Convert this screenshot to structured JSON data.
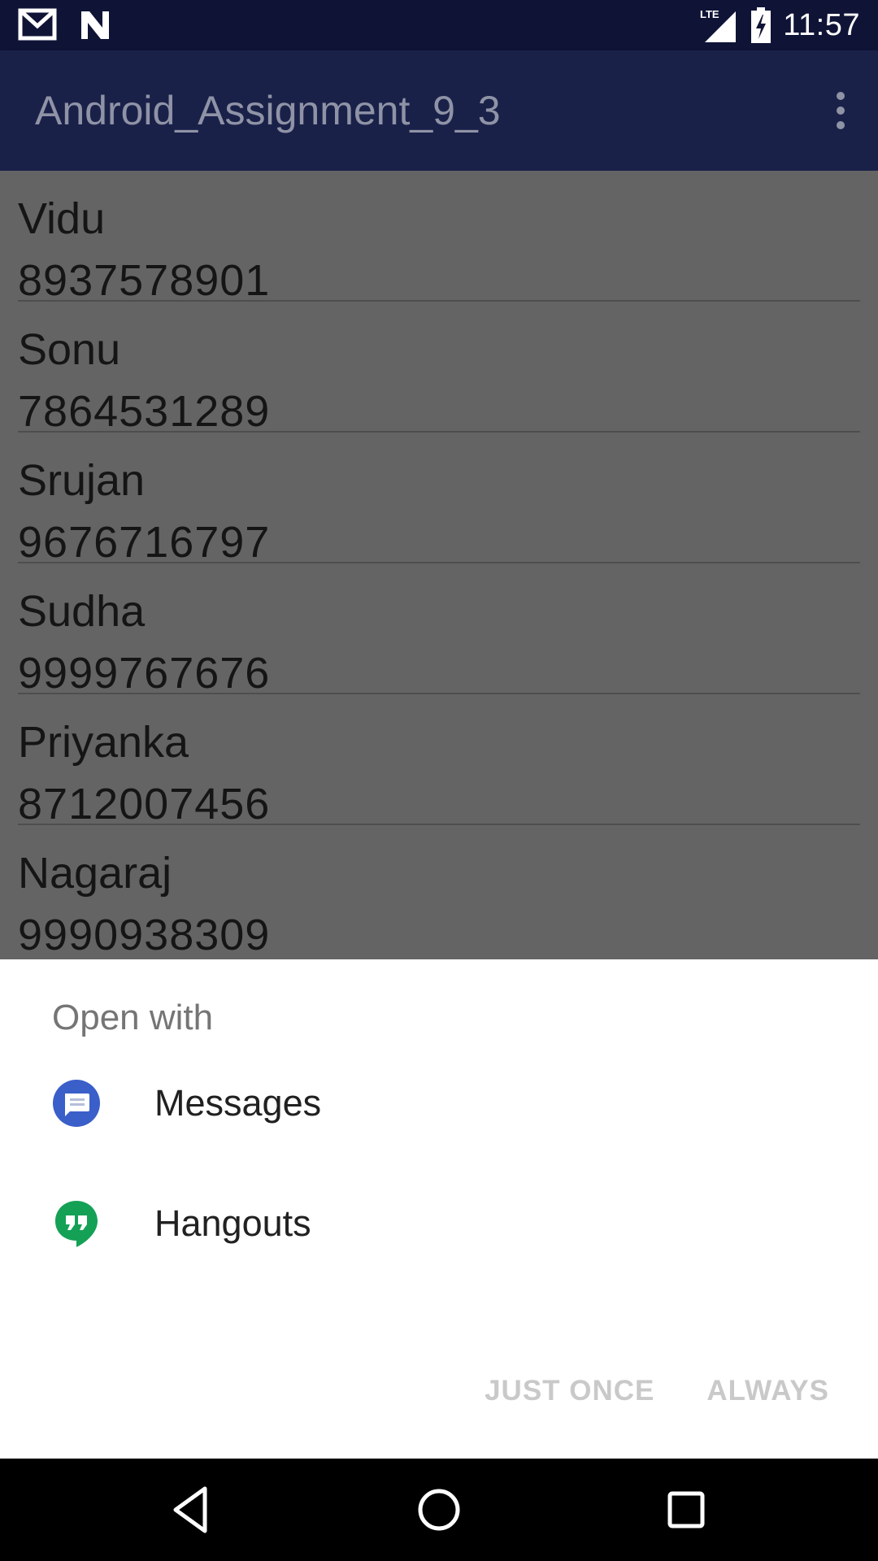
{
  "status_bar": {
    "time": "11:57",
    "network": "LTE",
    "icons": [
      "gmail-icon",
      "notification-n-icon",
      "signal-icon",
      "battery-charging-icon"
    ]
  },
  "app_bar": {
    "title": "Android_Assignment_9_3",
    "overflow_icon": "more-vert-icon"
  },
  "contacts": [
    {
      "name": "Vidu",
      "phone": "8937578901"
    },
    {
      "name": "Sonu",
      "phone": "7864531289"
    },
    {
      "name": "Srujan",
      "phone": "9676716797"
    },
    {
      "name": "Sudha",
      "phone": "9999767676"
    },
    {
      "name": "Priyanka",
      "phone": "8712007456"
    },
    {
      "name": "Nagaraj",
      "phone": "9990938309"
    }
  ],
  "chooser": {
    "heading": "Open with",
    "apps": [
      {
        "label": "Messages",
        "icon": "messages-icon",
        "color": "#3b5fc9"
      },
      {
        "label": "Hangouts",
        "icon": "hangouts-icon",
        "color": "#14a156"
      }
    ],
    "just_once_label": "JUST ONCE",
    "always_label": "ALWAYS"
  },
  "nav_bar": {
    "icons": [
      "back-icon",
      "home-icon",
      "recents-icon"
    ]
  }
}
